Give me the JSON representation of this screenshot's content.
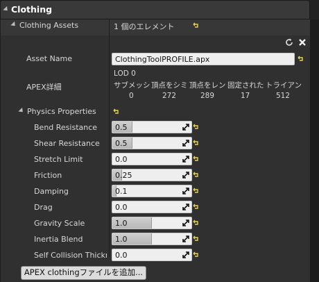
{
  "header": {
    "title": "Clothing"
  },
  "clothing_assets": {
    "label": "Clothing Assets",
    "value": "1 個のエレメント"
  },
  "asset": {
    "name_label": "Asset Name",
    "name_value": "ClothingToolPROFILE.apx",
    "details_label": "APEX詳細",
    "lod_title": "LOD 0",
    "columns": [
      "サブメッシ",
      "頂点をシミ",
      "頂点をレン",
      "固定された",
      "トライアン"
    ],
    "values": [
      "0",
      "272",
      "289",
      "17",
      "512"
    ]
  },
  "physics": {
    "section_label": "Physics Properties",
    "properties": [
      {
        "label": "Bend Resistance",
        "value": "0.5",
        "fill": 0.5
      },
      {
        "label": "Shear Resistance",
        "value": "0.5",
        "fill": 0.5
      },
      {
        "label": "Stretch Limit",
        "value": "0.0",
        "fill": 0.0
      },
      {
        "label": "Friction",
        "value": "0.25",
        "fill": 0.25
      },
      {
        "label": "Damping",
        "value": "0.1",
        "fill": 0.1
      },
      {
        "label": "Drag",
        "value": "0.0",
        "fill": 0.0
      },
      {
        "label": "Gravity Scale",
        "value": "1.0",
        "fill": 1.0
      },
      {
        "label": "Inertia Blend",
        "value": "1.0",
        "fill": 1.0
      },
      {
        "label": "Self Collision Thickne",
        "value": "0.0",
        "fill": 0.0
      }
    ]
  },
  "add_button": {
    "label": "APEX clothingファイルを追加..."
  },
  "colors": {
    "reset_yellow": "#e8d44d",
    "field_bg": "#eeeeee",
    "panel_bg": "#303030"
  },
  "icons": [
    "collapse-arrow-icon",
    "reset-icon",
    "refresh-icon",
    "close-icon",
    "expand-icon"
  ]
}
